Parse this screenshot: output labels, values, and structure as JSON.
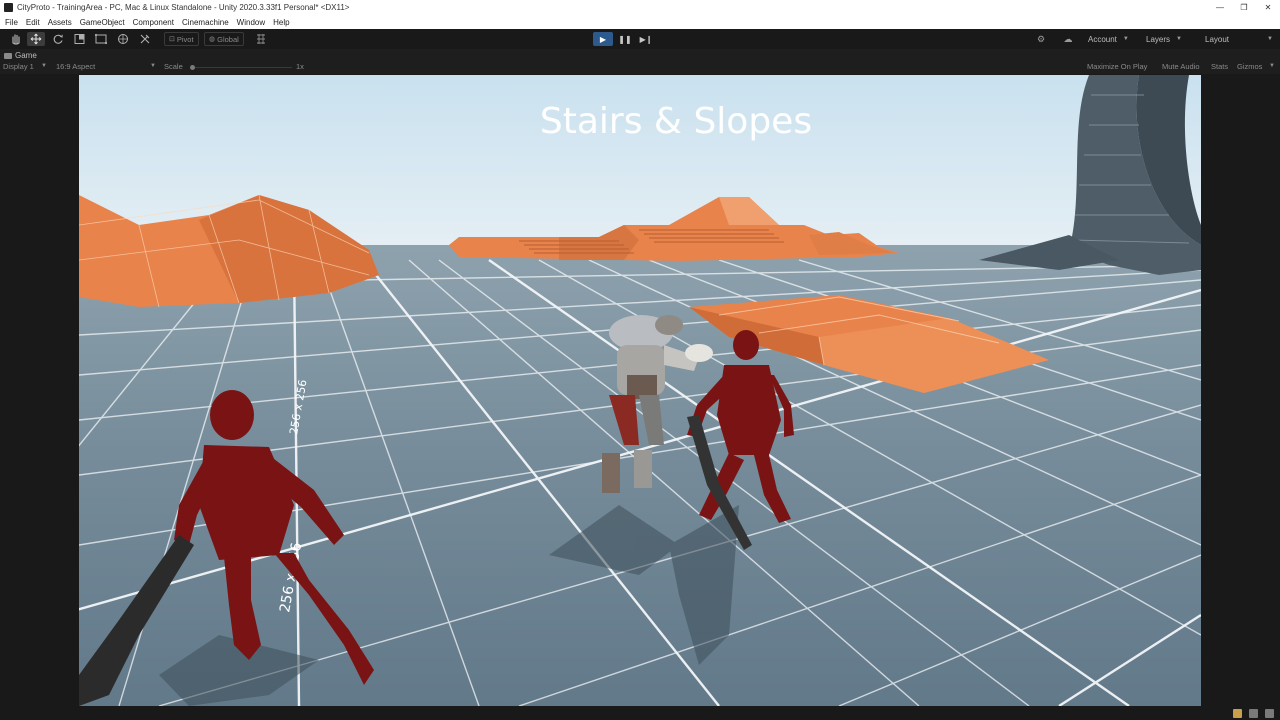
{
  "window": {
    "title": "CityProto - TrainingArea - PC, Mac & Linux Standalone - Unity 2020.3.33f1 Personal* <DX11>",
    "controls": [
      "—",
      "❐",
      "✕"
    ]
  },
  "menu": {
    "items": [
      "File",
      "Edit",
      "Assets",
      "GameObject",
      "Component",
      "Cinemachine",
      "Window",
      "Help"
    ]
  },
  "toolbar": {
    "tools": [
      "hand-tool",
      "move-tool",
      "rotate-tool",
      "scale-tool",
      "rect-tool",
      "transform-tool",
      "custom-tool"
    ],
    "pivot_label": "Pivot",
    "global_label": "Global",
    "account_label": "Account",
    "layers_label": "Layers",
    "layout_label": "Layout"
  },
  "game_view": {
    "tab_label": "Game",
    "display_label": "Display 1",
    "aspect_label": "16:9 Aspect",
    "scale_label": "Scale",
    "scale_value": "1x",
    "maximize_label": "Maximize On Play",
    "mute_label": "Mute Audio",
    "stats_label": "Stats",
    "gizmos_label": "Gizmos"
  },
  "scene": {
    "sign_text": "Stairs & Slopes",
    "grid_label_a": "256 x 256",
    "grid_label_b": "256 x 256",
    "colors": {
      "sky": "#bcd8ea",
      "floor": "#6d8697",
      "grid": "#f2f6f9",
      "ramps": "#e8834c",
      "enemy": "#7a1414"
    }
  }
}
